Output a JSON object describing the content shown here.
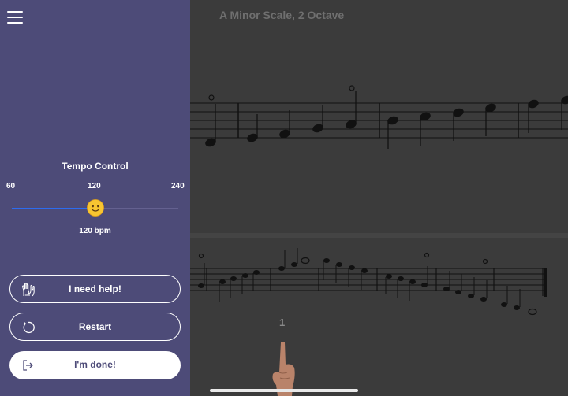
{
  "score": {
    "title": "A Minor Scale, 2 Octave",
    "measure_number": "1"
  },
  "sidebar": {
    "tempo": {
      "title": "Tempo Control",
      "min_label": "60",
      "mid_label": "120",
      "max_label": "240",
      "min": 60,
      "max": 240,
      "value": 120,
      "value_label": "120 bpm"
    },
    "buttons": {
      "help": "I need help!",
      "restart": "Restart",
      "done": "I'm done!"
    }
  },
  "icons": {
    "menu": "hamburger-menu-icon",
    "slider_thumb": "smiley-face-icon",
    "help": "raised-hands-icon",
    "restart": "restart-arrow-icon",
    "done": "exit-icon",
    "pointer": "pointing-finger-icon"
  },
  "colors": {
    "sidebar_bg": "#4d4b78",
    "main_bg": "#3b3b3b",
    "slider_fill": "#2d6cf0"
  }
}
